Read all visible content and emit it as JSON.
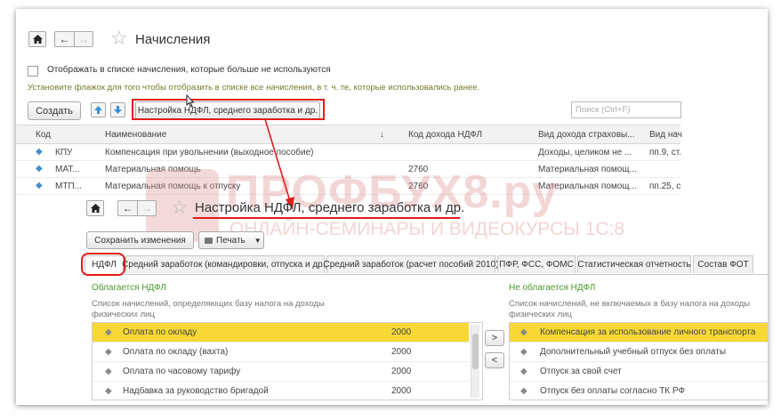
{
  "top": {
    "title": "Начисления",
    "checkbox_label": "Отображать в списке начисления, которые больше не используются",
    "hint": "Установите флажок для того чтобы отобразить в списке все начисления, в т. ч. те, которые использовались ранее.",
    "create_label": "Создать",
    "settings_label": "Настройка НДФЛ, среднего заработка и др.",
    "search_placeholder": "Поиск (Ctrl+F)",
    "columns": [
      "Код",
      "Наименование",
      "Код дохода НДФЛ",
      "Вид дохода страховы...",
      "Вид нач"
    ],
    "rows": [
      {
        "code": "КПУ",
        "name": "Компенсация при увольнении (выходное пособие)",
        "ndfl": "",
        "kind": "Доходы, целиком не ...",
        "extra": "пп.9, ст."
      },
      {
        "code": "МАТ...",
        "name": "Материальная помощь",
        "ndfl": "2760",
        "kind": "Материальная помощ...",
        "extra": ""
      },
      {
        "code": "МТП...",
        "name": "Материальная помощь к отпуску",
        "ndfl": "2760",
        "kind": "Материальная помощ...",
        "extra": "пп.25, с"
      }
    ]
  },
  "bottom": {
    "title": "Настройка НДФЛ, среднего заработка и др.",
    "save_label": "Сохранить изменения",
    "print_label": "Печать",
    "tabs": [
      "НДФЛ",
      "Средний заработок (командировки, отпуска и др.)",
      "Средний заработок (расчет пособий 2010)",
      "ПФР, ФСС, ФОМС",
      "Статистическая отчетность",
      "Состав ФОТ"
    ],
    "left_title": "Облагается НДФЛ",
    "left_desc": "Список начислений, определяющих базу налога на доходы физических лиц",
    "left_rows": [
      {
        "name": "Оплата по окладу",
        "code": "2000"
      },
      {
        "name": "Оплата по окладу (вахта)",
        "code": "2000"
      },
      {
        "name": "Оплата по часовому тарифу",
        "code": "2000"
      },
      {
        "name": "Надбавка за руководство бригадой",
        "code": "2000"
      }
    ],
    "right_title": "Не облагается НДФЛ",
    "right_desc": "Список начислений, не включаемых в базу налога на доходы физических лиц",
    "right_rows": [
      "Компенсация за использование личного транспорта",
      "Дополнительный учебный отпуск без оплаты",
      "Отпуск за свой счет",
      "Отпуск без оплаты согласно ТК РФ"
    ],
    "move_right": ">",
    "move_left": "<"
  },
  "watermark": {
    "brand": "ПРОФБУХ8.ру",
    "sub": "ОНЛАЙН-СЕМИНАРЫ И ВИДЕОКУРСЫ 1С:8"
  },
  "colors": {
    "annotation_red": "#e21b1b",
    "hint_green": "#7a7a2a",
    "selection_yellow": "#f7d836",
    "section_green": "#4a9a2c",
    "watermark": "#e3b1b1"
  }
}
